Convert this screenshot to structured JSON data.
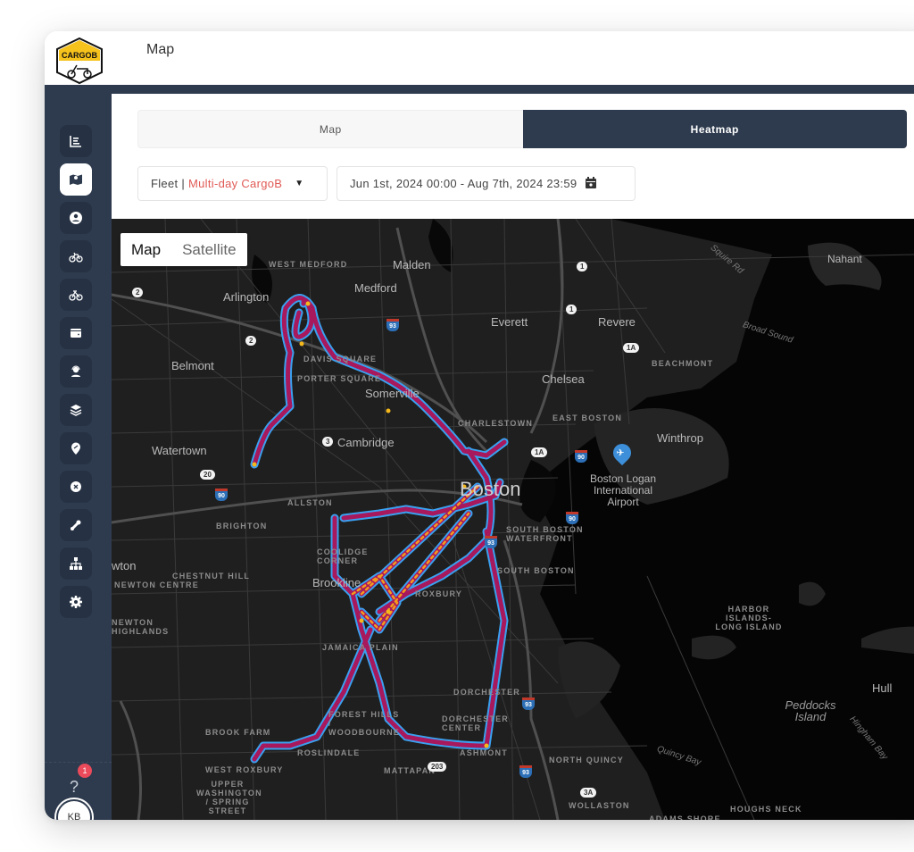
{
  "app": {
    "logo_text": "CARGOB",
    "page_title": "Map"
  },
  "sidebar": {
    "items": [
      {
        "name": "dashboard",
        "icon": "chart-list-icon",
        "active": false
      },
      {
        "name": "map",
        "icon": "map-icon",
        "active": true
      },
      {
        "name": "users",
        "icon": "user-circle-icon",
        "active": false
      },
      {
        "name": "bikes",
        "icon": "bicycle-icon",
        "active": false
      },
      {
        "name": "cargo-bikes",
        "icon": "cargo-bike-icon",
        "active": false
      },
      {
        "name": "wallet",
        "icon": "wallet-icon",
        "active": false
      },
      {
        "name": "support",
        "icon": "headset-icon",
        "active": false
      },
      {
        "name": "layers",
        "icon": "layers-icon",
        "active": false
      },
      {
        "name": "locations",
        "icon": "location-pin-icon",
        "active": false
      },
      {
        "name": "parts",
        "icon": "gear-badge-icon",
        "active": false
      },
      {
        "name": "tools",
        "icon": "tools-icon",
        "active": false
      },
      {
        "name": "organization",
        "icon": "sitemap-icon",
        "active": false
      },
      {
        "name": "settings",
        "icon": "settings-icon",
        "active": false
      }
    ],
    "help_label": "?",
    "help_badge_count": "1",
    "avatar_initials": "KB"
  },
  "tabs": [
    {
      "label": "Map",
      "active": false
    },
    {
      "label": "Heatmap",
      "active": true
    }
  ],
  "filters": {
    "fleet_prefix": "Fleet |",
    "fleet_value": "Multi-day CargoB",
    "fleet_accent": "#e05a55",
    "date_range": "Jun 1st, 2024 00:00 - Aug 7th, 2024 23:59"
  },
  "map": {
    "type_control": {
      "map_label": "Map",
      "satellite_label": "Satellite",
      "selected": "Map"
    },
    "places": {
      "west_medford": "WEST MEDFORD",
      "malden": "Malden",
      "medford": "Medford",
      "nahant": "Nahant",
      "arlington": "Arlington",
      "everett": "Everett",
      "revere": "Revere",
      "broad_sound": "Broad Sound",
      "belmont": "Belmont",
      "davis_square": "DAVIS SQUARE",
      "porter_square": "PORTER SQUARE",
      "somerville": "Somerville",
      "chelsea": "Chelsea",
      "beachmont": "BEACHMONT",
      "charlestown": "CHARLESTOWN",
      "east_boston": "EAST BOSTON",
      "watertown": "Watertown",
      "cambridge": "Cambridge",
      "winthrop": "Winthrop",
      "boston": "Boston",
      "logan": "Boston Logan International Airport",
      "allston": "ALLSTON",
      "brighton": "BRIGHTON",
      "south_boston_waterfront": "SOUTH BOSTON WATERFRONT",
      "newton": "wton",
      "coolidge_corner": "COOLIDGE CORNER",
      "south_boston": "SOUTH BOSTON",
      "chestnut_hill": "CHESTNUT HILL",
      "newton_centre": "NEWTON CENTRE",
      "brookline": "Brookline",
      "roxbury": "ROXBURY",
      "newton_highlands": "NEWTON HIGHLANDS",
      "harbor_islands": "HARBOR ISLANDS-LONG ISLAND",
      "jamaica_plain": "JAMAICA PLAIN",
      "hull": "Hull",
      "dorchester": "DORCHESTER",
      "peddocks": "Peddocks Island",
      "brook_farm": "BROOK FARM",
      "forest_hills": "FOREST HILLS / WOODBOURNE",
      "dorchester_center": "DORCHESTER CENTER",
      "quincy_bay": "Quincy Bay",
      "hingham_bay": "Hingham Bay",
      "roslindale": "ROSLINDALE",
      "ashmont": "ASHMONT",
      "north_quincy": "NORTH QUINCY",
      "west_roxbury": "WEST ROXBURY",
      "mattapan": "MATTAPAN",
      "upper_washington": "UPPER WASHINGTON / SPRING STREET",
      "wollaston": "WOLLASTON",
      "adams_shore": "ADAMS SHORE",
      "houghs_neck": "HOUGHS NECK",
      "squire_rd": "Squire Rd"
    },
    "route_shields": [
      "2",
      "2",
      "1",
      "1",
      "1A",
      "1A",
      "3",
      "20",
      "90",
      "90",
      "90",
      "93",
      "93",
      "93",
      "93",
      "203",
      "3A"
    ],
    "heatmap_colors": {
      "low": "#3aa0f0",
      "mid": "#a8185c",
      "high": "#f59d1b"
    }
  }
}
